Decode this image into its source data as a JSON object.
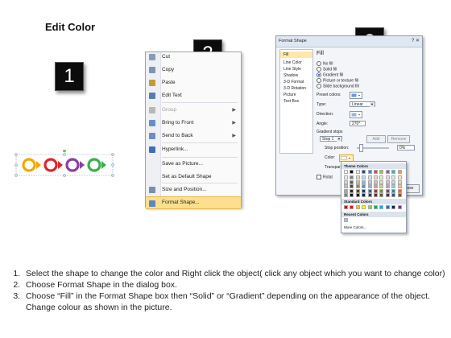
{
  "title": "Edit Color",
  "badges": [
    "1",
    "2",
    "3"
  ],
  "shape_colors": [
    "#f2a900",
    "#e0242c",
    "#8a3fa5",
    "#3dae49"
  ],
  "context_menu": {
    "items": [
      {
        "label": "Cut",
        "icon": "scissors-icon",
        "icon_color": "#8a9bb8",
        "disabled": false,
        "submenu": false
      },
      {
        "label": "Copy",
        "icon": "copy-icon",
        "icon_color": "#7f94b5",
        "disabled": false,
        "submenu": false
      },
      {
        "label": "Paste",
        "icon": "paste-icon",
        "icon_color": "#c49a3a",
        "disabled": false,
        "submenu": false
      },
      {
        "label": "Edit Text",
        "icon": "edit-text-icon",
        "icon_color": "#5a7db0",
        "disabled": false,
        "submenu": false
      },
      {
        "label": "Group",
        "icon": "group-icon",
        "icon_color": "#b8b8b8",
        "disabled": true,
        "submenu": true
      },
      {
        "label": "Bring to Front",
        "icon": "bring-front-icon",
        "icon_color": "#6d8fbf",
        "disabled": false,
        "submenu": true
      },
      {
        "label": "Send to Back",
        "icon": "send-back-icon",
        "icon_color": "#6d8fbf",
        "disabled": false,
        "submenu": true
      },
      {
        "label": "Hyperlink...",
        "icon": "hyperlink-icon",
        "icon_color": "#3f6fb5",
        "disabled": false,
        "submenu": false
      },
      {
        "label": "Save as Picture...",
        "icon": "",
        "icon_color": "",
        "disabled": false,
        "submenu": false
      },
      {
        "label": "Set as Default Shape",
        "icon": "",
        "icon_color": "",
        "disabled": false,
        "submenu": false
      },
      {
        "label": "Size and Position...",
        "icon": "size-position-icon",
        "icon_color": "#7a8fae",
        "disabled": false,
        "submenu": false
      },
      {
        "label": "Format Shape...",
        "icon": "format-shape-icon",
        "icon_color": "#5c87c6",
        "disabled": false,
        "submenu": false,
        "highlighted": true
      }
    ]
  },
  "dialog": {
    "title": "Format Shape",
    "nav": [
      "Fill",
      "Line Color",
      "Line Style",
      "Shadow",
      "3-D Format",
      "3-D Rotation",
      "Picture",
      "Text Box"
    ],
    "selected_nav": "Fill",
    "heading": "Fill",
    "fill_options": [
      "No fill",
      "Solid fill",
      "Gradient fill",
      "Picture or texture fill",
      "Slide background fill"
    ],
    "selected_fill": "Gradient fill",
    "preset_colors_label": "Preset colors:",
    "type_label": "Type:",
    "type_value": "Linear",
    "direction_label": "Direction:",
    "angle_label": "Angle:",
    "angle_value": "270°",
    "gradient_stops_label": "Gradient stops",
    "stop_value": "Stop 1",
    "add_label": "Add",
    "remove_label": "Remove",
    "stop_position_label": "Stop position:",
    "stop_position_value": "0%",
    "color_label": "Color:",
    "transparency_label": "Transpar",
    "rotate_label": "Rotat",
    "close_label": "Close"
  },
  "color_picker": {
    "theme_header": "Theme Colors",
    "standard_header": "Standard Colors",
    "recent_header": "Recent Colors",
    "more_label": "More Colors...",
    "theme_top": [
      "#ffffff",
      "#000000",
      "#eeece1",
      "#1f497d",
      "#4f81bd",
      "#c0504d",
      "#9bbb59",
      "#8064a2",
      "#4bacc6",
      "#f79646"
    ],
    "theme_shades": [
      [
        "#f2f2f2",
        "#7f7f7f",
        "#ddd9c3",
        "#c6d9f0",
        "#dbe5f1",
        "#f2dcdb",
        "#ebf1dd",
        "#e5e0ec",
        "#dbeef3",
        "#fdeada"
      ],
      [
        "#d8d8d8",
        "#595959",
        "#c4bd97",
        "#8db3e2",
        "#b8cce4",
        "#e5b9b7",
        "#d7e3bc",
        "#ccc1d9",
        "#b7dde8",
        "#fbd5b5"
      ],
      [
        "#bfbfbf",
        "#3f3f3f",
        "#938953",
        "#548dd4",
        "#95b3d7",
        "#d99694",
        "#c3d69b",
        "#b2a2c7",
        "#92cddc",
        "#fac08f"
      ],
      [
        "#a5a5a5",
        "#262626",
        "#494429",
        "#17365d",
        "#366092",
        "#953734",
        "#76923c",
        "#5f497a",
        "#31859b",
        "#e36c09"
      ],
      [
        "#7f7f7f",
        "#0c0c0c",
        "#1d1b10",
        "#0f243e",
        "#244061",
        "#632423",
        "#4f6128",
        "#3f3151",
        "#205867",
        "#974806"
      ]
    ],
    "standard": [
      "#c00000",
      "#ff0000",
      "#ffc000",
      "#ffff00",
      "#92d050",
      "#00b050",
      "#00b0f0",
      "#0070c0",
      "#002060",
      "#7030a0"
    ],
    "recent": [
      "#99cccc"
    ]
  },
  "instructions": [
    "Select the shape to change the color and Right click the object( click any object which you want to change color)",
    "Choose Format Shape in the dialog box.",
    "Choose “Fill” in the Format Shape box then “Solid” or “Gradient” depending on the appearance of the object. Change colour as shown in the picture."
  ]
}
